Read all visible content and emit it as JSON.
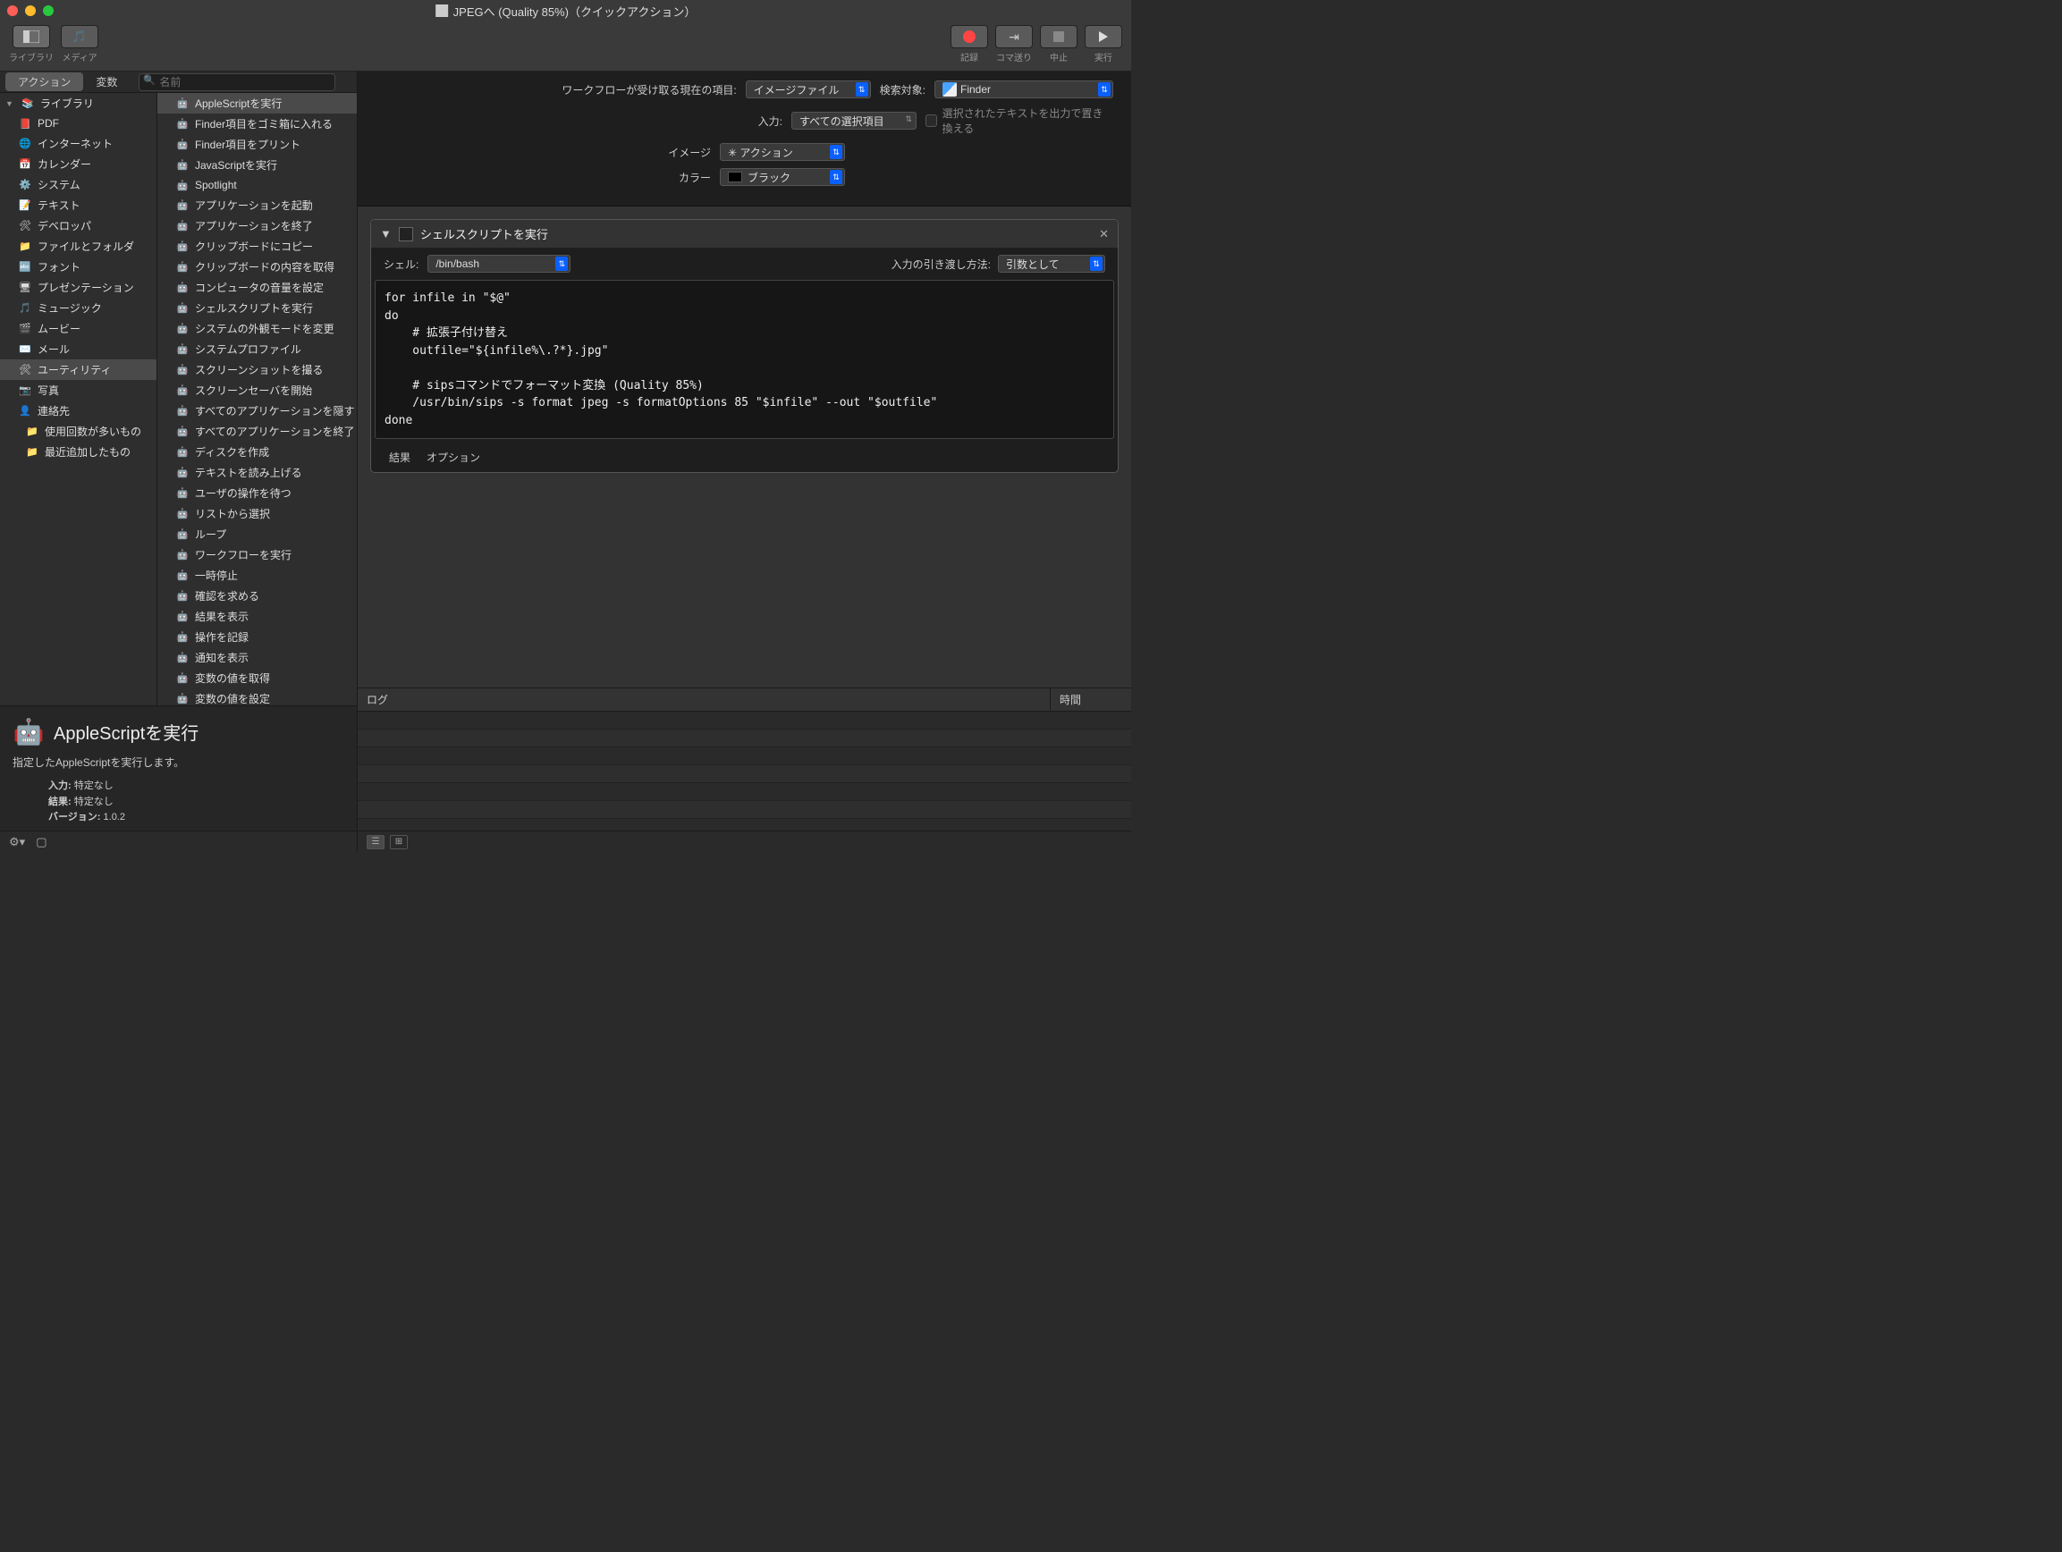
{
  "title": "JPEGへ (Quality 85%)（クイックアクション）",
  "toolbar": {
    "library": "ライブラリ",
    "media": "メディア",
    "record": "記録",
    "step": "コマ送り",
    "stop": "中止",
    "run": "実行"
  },
  "tabs": {
    "action": "アクション",
    "variable": "変数"
  },
  "search": {
    "placeholder": "名前"
  },
  "library": {
    "header": "ライブラリ",
    "items": [
      "PDF",
      "インターネット",
      "カレンダー",
      "システム",
      "テキスト",
      "デベロッパ",
      "ファイルとフォルダ",
      "フォント",
      "プレゼンテーション",
      "ミュージック",
      "ムービー",
      "メール",
      "ユーティリティ",
      "写真",
      "連絡先"
    ],
    "extras": [
      "使用回数が多いもの",
      "最近追加したもの"
    ]
  },
  "actions": [
    "AppleScriptを実行",
    "Finder項目をゴミ箱に入れる",
    "Finder項目をプリント",
    "JavaScriptを実行",
    "Spotlight",
    "アプリケーションを起動",
    "アプリケーションを終了",
    "クリップボードにコピー",
    "クリップボードの内容を取得",
    "コンピュータの音量を設定",
    "シェルスクリプトを実行",
    "システムの外観モードを変更",
    "システムプロファイル",
    "スクリーンショットを撮る",
    "スクリーンセーバを開始",
    "すべてのアプリケーションを隠す",
    "すべてのアプリケーションを終了",
    "ディスクを作成",
    "テキストを読み上げる",
    "ユーザの操作を待つ",
    "リストから選択",
    "ループ",
    "ワークフローを実行",
    "一時停止",
    "確認を求める",
    "結果を表示",
    "操作を記録",
    "通知を表示",
    "変数の値を取得",
    "変数の値を設定"
  ],
  "desc": {
    "title": "AppleScriptを実行",
    "text": "指定したAppleScriptを実行します。",
    "input_label": "入力:",
    "input_value": "特定なし",
    "result_label": "結果:",
    "result_value": "特定なし",
    "version_label": "バージョン:",
    "version_value": "1.0.2"
  },
  "wfheader": {
    "receives_label": "ワークフローが受け取る現在の項目:",
    "receives_value": "イメージファイル",
    "search_label": "検索対象:",
    "search_value": "Finder",
    "input_label": "入力:",
    "input_value": "すべての選択項目",
    "output_check": "選択されたテキストを出力で置き換える",
    "image_label": "イメージ",
    "image_value": "✳ アクション",
    "color_label": "カラー",
    "color_value": "ブラック"
  },
  "card": {
    "title": "シェルスクリプトを実行",
    "shell_label": "シェル:",
    "shell_value": "/bin/bash",
    "pass_label": "入力の引き渡し方法:",
    "pass_value": "引数として",
    "code": "for infile in \"$@\"\ndo\n    # 拡張子付け替え\n    outfile=\"${infile%\\.?*}.jpg\"\n\n    # sipsコマンドでフォーマット変換 (Quality 85%)\n    /usr/bin/sips -s format jpeg -s formatOptions 85 \"$infile\" --out \"$outfile\"\ndone",
    "footer_result": "結果",
    "footer_option": "オプション"
  },
  "log": {
    "col_log": "ログ",
    "col_time": "時間"
  }
}
